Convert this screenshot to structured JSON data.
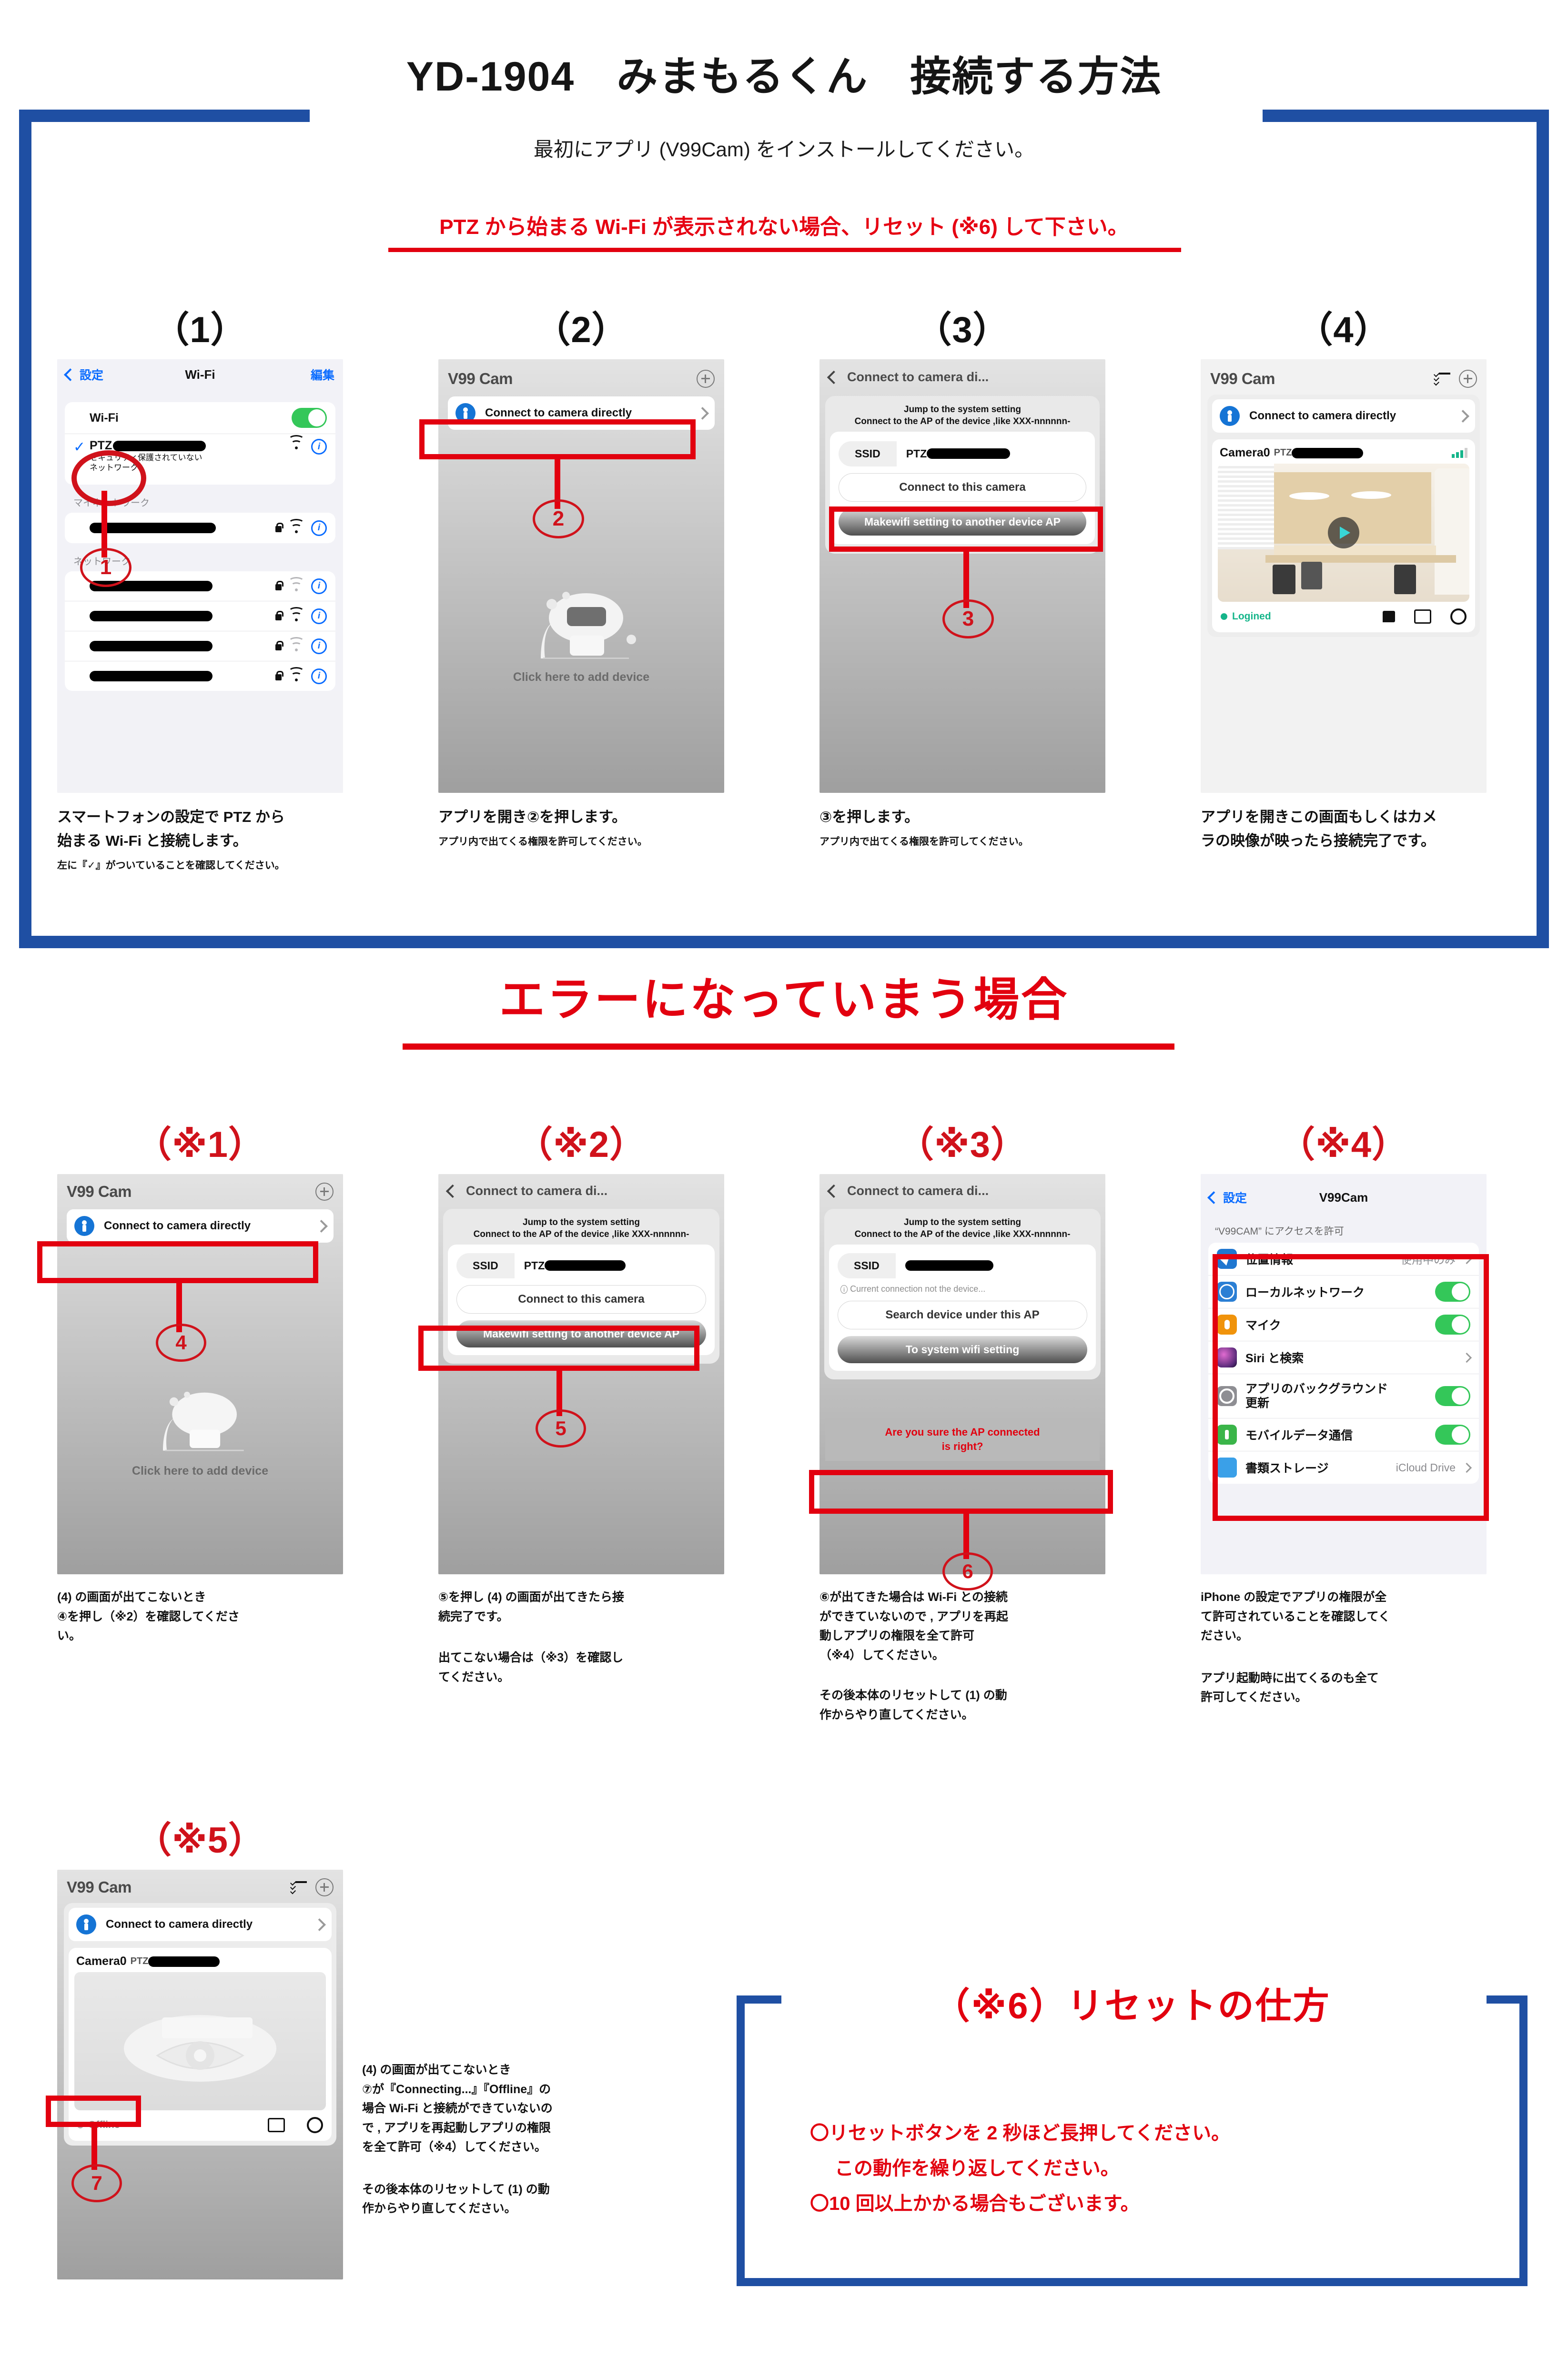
{
  "header": {
    "title": "YD-1904　みまもるくん　接続する方法",
    "subtitle": "最初にアプリ (V99Cam) をインストールしてください。",
    "warning": "PTZ から始まる Wi-Fi が表示されない場合、リセット (※6) して下さい。"
  },
  "colors": {
    "blue_frame": "#1f4fa3",
    "red_accent": "#e2000f",
    "marker_red": "#d0121b",
    "ios_blue": "#0a6cff",
    "toggle_green": "#34c759"
  },
  "steps": [
    {
      "num": "（1）",
      "screen": {
        "kind": "ios-wifi",
        "back_label": "設定",
        "title": "Wi-Fi",
        "edit_label": "編集",
        "wifi_row_label": "Wi-Fi",
        "ptz_ssid": "PTZ",
        "ptz_sub": "セキュリティ保護されていない\nネットワーク",
        "group_my": "マイネットワーク",
        "group_networks": "ネットワーク"
      },
      "marker": "1",
      "caption_big": "スマートフォンの設定で PTZ から\n始まる Wi-Fi と接続します。",
      "caption_small": "左に『✓』がついていることを確認してください。"
    },
    {
      "num": "（2）",
      "screen": {
        "kind": "app-home-empty",
        "app_title": "V99 Cam",
        "connect_label": "Connect to camera directly",
        "empty_label": "Click here to add device"
      },
      "marker": "2",
      "caption_big": "アプリを開き②を押します。",
      "caption_small": "アプリ内で出てくる権限を許可してください。"
    },
    {
      "num": "（3）",
      "screen": {
        "kind": "connect-direct",
        "title": "Connect to camera di...",
        "note_line1": "Jump to the system setting",
        "note_line2": "Connect to the AP of the device ,like XXX-nnnnnn-",
        "ssid_key": "SSID",
        "ssid_val": "PTZ",
        "btn_connect": "Connect to this camera",
        "btn_makewifi": "Makewifi setting to another device AP"
      },
      "marker": "3",
      "caption_big": "③を押します。",
      "caption_small": "アプリ内で出てくる権限を許可してください。"
    },
    {
      "num": "（4）",
      "screen": {
        "kind": "app-home-camera",
        "app_title": "V99 Cam",
        "connect_label": "Connect to camera directly",
        "camera_name": "Camera0",
        "camera_ssid": "PTZ",
        "status": "Logined"
      },
      "marker": "",
      "caption_big": "アプリを開きこの画面もしくはカメ\nラの映像が映ったら接続完了です。",
      "caption_small": ""
    }
  ],
  "error_section": {
    "heading": "エラーになっていまう場合",
    "items": [
      {
        "num": "（※1）",
        "screen": {
          "kind": "app-home-empty",
          "app_title": "V99 Cam",
          "connect_label": "Connect to camera directly",
          "empty_label": "Click here to add device"
        },
        "marker": "4",
        "caption": "(4) の画面が出てこないとき\n④を押し（※2）を確認してくださ\nい。",
        "caption2": ""
      },
      {
        "num": "（※2）",
        "screen": {
          "kind": "connect-direct",
          "title": "Connect to camera di...",
          "note_line1": "Jump to the system setting",
          "note_line2": "Connect to the AP of the device ,like XXX-nnnnnn-",
          "ssid_key": "SSID",
          "ssid_val": "PTZ",
          "btn_connect": "Connect to this camera",
          "btn_makewifi": "Makewifi setting to another device AP"
        },
        "marker": "5",
        "caption": "⑤を押し (4) の画面が出てきたら接\n続完了です。",
        "caption2": "出てこない場合は（※3）を確認し\nてください。"
      },
      {
        "num": "（※3）",
        "screen": {
          "kind": "connect-direct-error",
          "title": "Connect to camera di...",
          "note_line1": "Jump to the system setting",
          "note_line2": "Connect to the AP of the device ,like XXX-nnnnnn-",
          "ssid_key": "SSID",
          "hint": "Current connection not the device...",
          "btn_search": "Search device under this AP",
          "btn_system": "To system wifi setting",
          "error_text": "Are you sure the AP connected\nis right?"
        },
        "marker": "6",
        "caption": "⑥が出てきた場合は Wi-Fi との接続\nができていないので , アプリを再起\n動しアプリの権限を全て許可\n（※4）してください。",
        "caption2": "その後本体のリセットして (1) の動\n作からやり直してください。"
      },
      {
        "num": "（※4）",
        "screen": {
          "kind": "ios-permissions",
          "back_label": "設定",
          "title": "V99Cam",
          "group_header": "“V99CAM” にアクセスを許可",
          "rows": [
            {
              "label": "位置情報",
              "value": "使用中のみ",
              "control": "chevron",
              "icon": "location-icon",
              "icon_color": "#1f77d0"
            },
            {
              "label": "ローカルネットワーク",
              "value": "",
              "control": "toggle-on",
              "icon": "globe-icon",
              "icon_color": "#2b7fd4"
            },
            {
              "label": "マイク",
              "value": "",
              "control": "toggle-on",
              "icon": "microphone-icon",
              "icon_color": "#f0930b"
            },
            {
              "label": "Siri と検索",
              "value": "",
              "control": "chevron",
              "icon": "siri-icon",
              "icon_color": "#3a2340"
            },
            {
              "label": "アプリのバックグラウンド\n更新",
              "value": "",
              "control": "toggle-on",
              "icon": "gear-icon",
              "icon_color": "#8e8e93"
            },
            {
              "label": "モバイルデータ通信",
              "value": "",
              "control": "toggle-on",
              "icon": "cellular-icon",
              "icon_color": "#3ab549"
            },
            {
              "label": "書類ストレージ",
              "value": "iCloud Drive",
              "control": "chevron",
              "icon": "folder-icon",
              "icon_color": "#3aa0e8"
            }
          ]
        },
        "marker": "",
        "caption": "iPhone の設定でアプリの権限が全\nて許可されていることを確認してく\nださい。",
        "caption2": "アプリ起動時に出てくるのも全て\n許可してください。"
      }
    ],
    "item5": {
      "num": "（※5）",
      "screen": {
        "kind": "app-home-offline",
        "app_title": "V99 Cam",
        "connect_label": "Connect to camera directly",
        "camera_name": "Camera0",
        "camera_ssid": "PTZ",
        "status": "Offline"
      },
      "marker": "7",
      "caption": "(4) の画面が出てこないとき\n⑦が『Connecting...』『Offline』の\n場合 Wi-Fi と接続ができていないの\nで , アプリを再起動しアプリの権限\nを全て許可（※4）してください。",
      "caption2": "その後本体のリセットして (1) の動\n作からやり直してください。"
    }
  },
  "reset_box": {
    "title": "（※6）リセットの仕方",
    "lines": [
      "〇リセットボタンを 2 秒ほど長押してください。",
      "この動作を繰り返してください。",
      "〇10 回以上かかる場合もございます。"
    ]
  }
}
